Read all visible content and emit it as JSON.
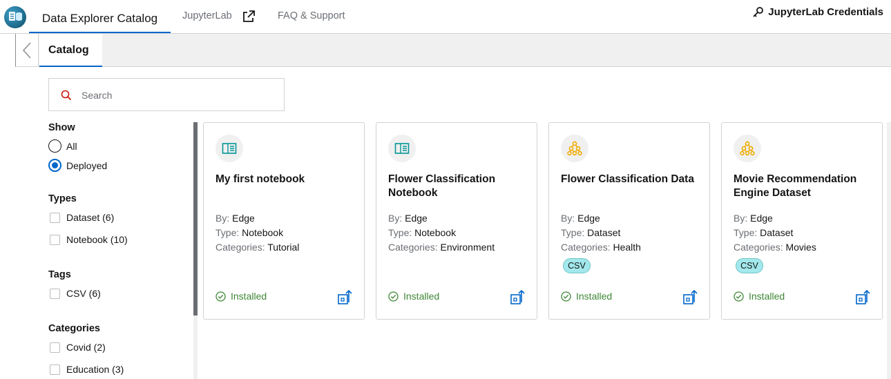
{
  "nav": {
    "main_tab": "Data Explorer Catalog",
    "jupyterlab": "JupyterLab",
    "faq": "FAQ & Support",
    "credentials": "JupyterLab Credentials"
  },
  "catalog_bar": {
    "tab": "Catalog"
  },
  "search": {
    "placeholder": "Search",
    "value": ""
  },
  "filters": {
    "show": {
      "heading": "Show",
      "options": [
        "All",
        "Deployed"
      ],
      "selected": "Deployed"
    },
    "types": {
      "heading": "Types",
      "options": [
        "Dataset (6)",
        "Notebook (10)"
      ]
    },
    "tags": {
      "heading": "Tags",
      "options": [
        "CSV (6)"
      ]
    },
    "categories": {
      "heading": "Categories",
      "options": [
        "Covid (2)",
        "Education (3)"
      ]
    }
  },
  "meta_labels": {
    "by": "By:",
    "type": "Type:",
    "categories": "Categories:"
  },
  "cards": [
    {
      "icon": "notebook-icon",
      "title": "My first notebook",
      "by": "Edge",
      "type": "Notebook",
      "categories": "Tutorial",
      "badge": "",
      "status": "Installed"
    },
    {
      "icon": "notebook-icon",
      "title": "Flower Classification Notebook",
      "by": "Edge",
      "type": "Notebook",
      "categories": "Environment",
      "badge": "",
      "status": "Installed"
    },
    {
      "icon": "dataset-icon",
      "title": "Flower Classification Data",
      "by": "Edge",
      "type": "Dataset",
      "categories": "Health",
      "badge": "CSV",
      "status": "Installed"
    },
    {
      "icon": "dataset-icon",
      "title": "Movie Recommendation Engine Dataset",
      "by": "Edge",
      "type": "Dataset",
      "categories": "Movies",
      "badge": "CSV",
      "status": "Installed"
    }
  ],
  "colors": {
    "accent": "#0066cc",
    "installed": "#3e8635",
    "notebook_icon": "#009596",
    "dataset_icon": "#f0ab00",
    "badge_bg": "#a2e8ec"
  }
}
